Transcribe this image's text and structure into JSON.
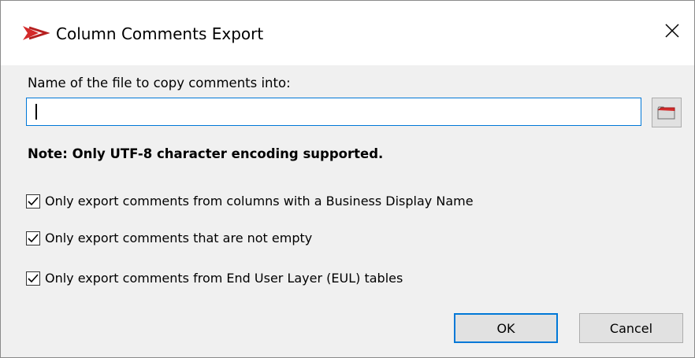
{
  "window": {
    "title": "Column Comments Export",
    "app_icon": "red-chevron-logo-icon",
    "close_icon": "close-icon"
  },
  "form": {
    "file_label": "Name of the file to copy comments into:",
    "file_value": "",
    "file_placeholder": "",
    "browse_icon": "folder-icon",
    "note": "Note: Only UTF-8 character encoding supported."
  },
  "options": [
    {
      "label": "Only export comments from columns with a Business Display Name",
      "checked": true
    },
    {
      "label": "Only export comments that are not empty",
      "checked": true
    },
    {
      "label": "Only export comments from End User Layer (EUL) tables",
      "checked": true
    }
  ],
  "buttons": {
    "ok_label": "OK",
    "cancel_label": "Cancel"
  },
  "colors": {
    "accent": "#0078d7",
    "brand_red": "#d42a2a"
  }
}
